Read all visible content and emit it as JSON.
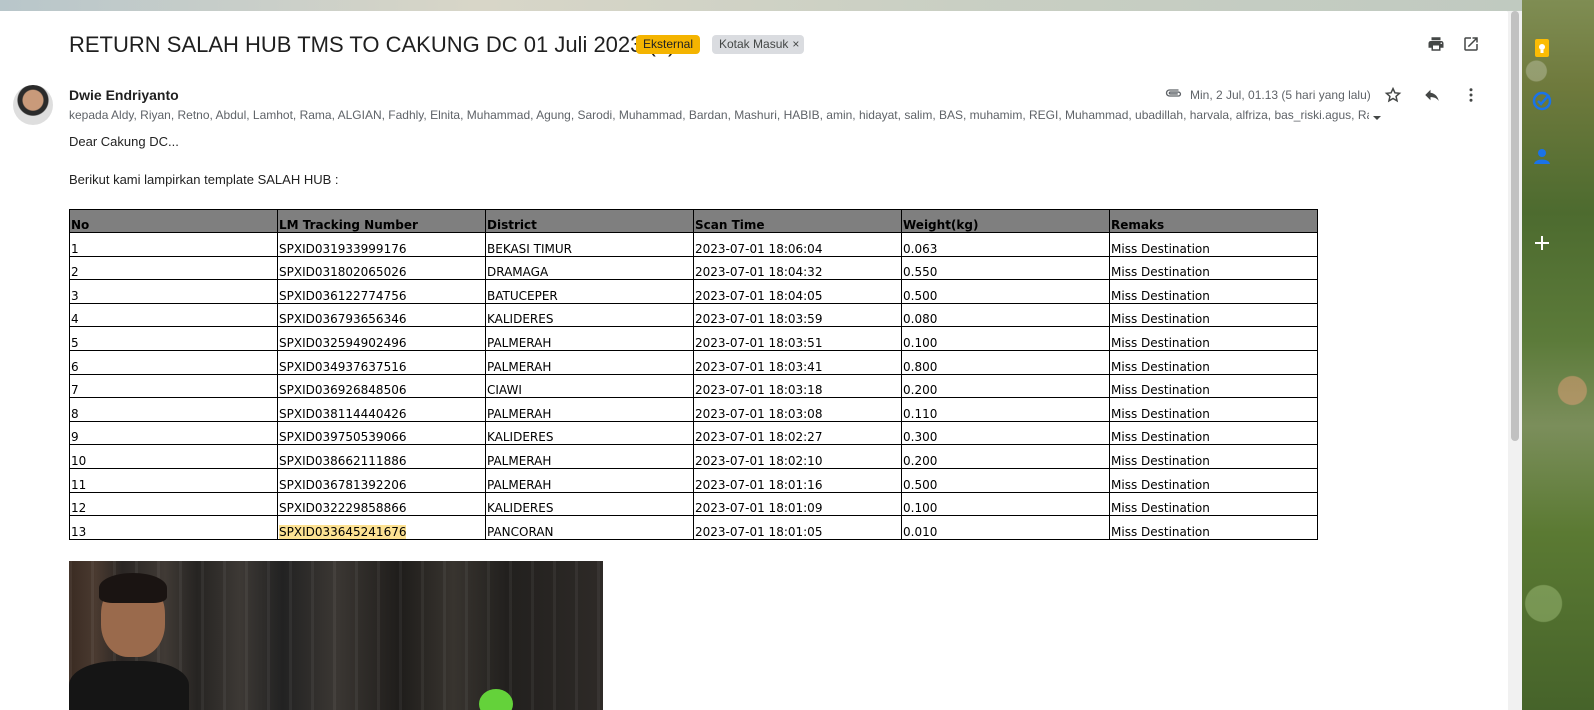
{
  "email": {
    "subject": "RETURN SALAH HUB TMS TO CAKUNG DC 01 Juli 2023 (3)",
    "labels": {
      "external": "Eksternal",
      "inbox": "Kotak Masuk",
      "inbox_remove": "×"
    },
    "header_actions": {
      "print_icon": "printer-icon",
      "popout_icon": "open-in-new-window-icon"
    },
    "sender": {
      "name": "Dwie Endriyanto",
      "recipients": "kepada Aldy, Riyan, Retno, Abdul, Lamhot, Rama, ALGIAN, Fadhly, Elnita, Muhammad, Agung, Sarodi, Muhammad, Bardan, Mashuri, HABIB, amin, hidayat, salim, BAS, muhamim, REGI, Muhammad, ubadillah, harvala, alfriza, bas_riski.agus, Ravi, G",
      "timestamp": "Min, 2 Jul, 01.13 (5 hari yang lalu)"
    },
    "message_actions": [
      "star-icon",
      "reply-icon",
      "more-vert-icon"
    ]
  },
  "body": {
    "greeting": "Dear Cakung DC...",
    "intro": "Berikut kami lampirkan template SALAH HUB :"
  },
  "table": {
    "headers": [
      "No",
      "LM Tracking Number",
      "District",
      "Scan Time",
      "Weight(kg)",
      "Remaks"
    ],
    "rows": [
      [
        "1",
        "SPXID031933999176",
        "BEKASI TIMUR",
        "2023-07-01 18:06:04",
        "0.063",
        "Miss Destination"
      ],
      [
        "2",
        "SPXID031802065026",
        "DRAMAGA",
        "2023-07-01 18:04:32",
        "0.550",
        "Miss Destination"
      ],
      [
        "3",
        "SPXID036122774756",
        "BATUCEPER",
        "2023-07-01 18:04:05",
        "0.500",
        "Miss Destination"
      ],
      [
        "4",
        "SPXID036793656346",
        "KALIDERES",
        "2023-07-01 18:03:59",
        "0.080",
        "Miss Destination"
      ],
      [
        "5",
        "SPXID032594902496",
        "PALMERAH",
        "2023-07-01 18:03:51",
        "0.100",
        "Miss Destination"
      ],
      [
        "6",
        "SPXID034937637516",
        "PALMERAH",
        "2023-07-01 18:03:41",
        "0.800",
        "Miss Destination"
      ],
      [
        "7",
        "SPXID036926848506",
        "CIAWI",
        "2023-07-01 18:03:18",
        "0.200",
        "Miss Destination"
      ],
      [
        "8",
        "SPXID038114440426",
        "PALMERAH",
        "2023-07-01 18:03:08",
        "0.110",
        "Miss Destination"
      ],
      [
        "9",
        "SPXID039750539066",
        "KALIDERES",
        "2023-07-01 18:02:27",
        "0.300",
        "Miss Destination"
      ],
      [
        "10",
        "SPXID038662111886",
        "PALMERAH",
        "2023-07-01 18:02:10",
        "0.200",
        "Miss Destination"
      ],
      [
        "11",
        "SPXID036781392206",
        "PALMERAH",
        "2023-07-01 18:01:16",
        "0.500",
        "Miss Destination"
      ],
      [
        "12",
        "SPXID032229858866",
        "KALIDERES",
        "2023-07-01 18:01:09",
        "0.100",
        "Miss Destination"
      ],
      [
        "13",
        "SPXID033645241676",
        "PANCORAN",
        "2023-07-01 18:01:05",
        "0.010",
        "Miss Destination"
      ]
    ],
    "highlighted_cell": {
      "row": 13,
      "column": "LM Tracking Number"
    }
  },
  "side_panel": [
    "keep-icon",
    "tasks-icon",
    "contacts-icon",
    "add-icon"
  ],
  "colors": {
    "external_badge": "#f4b400",
    "inbox_badge": "#dadce0",
    "table_header": "#7f7f7f",
    "highlight": "#fde293",
    "keep_yellow": "#fbbc04",
    "tasks_blue": "#1a73e8"
  }
}
